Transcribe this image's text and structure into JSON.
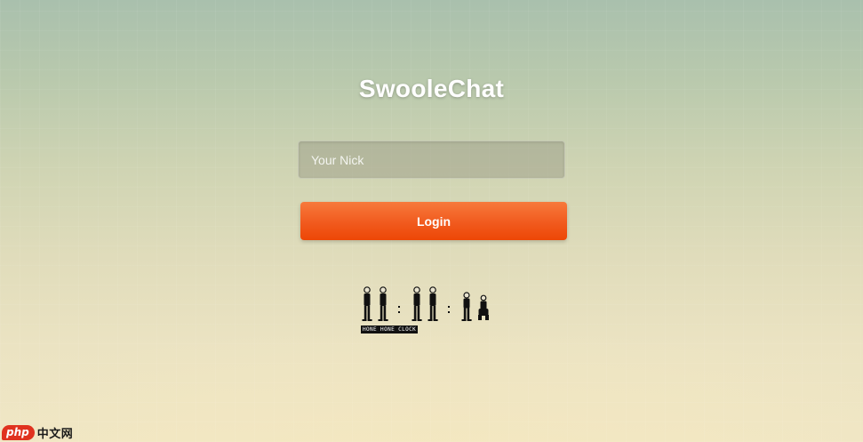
{
  "app": {
    "title": "SwooleChat"
  },
  "form": {
    "nick_value": "",
    "nick_placeholder": "Your Nick",
    "login_label": "Login"
  },
  "clock": {
    "caption": "HONE HONE CLOCK"
  },
  "watermark": {
    "php_text": "php",
    "site_text": "中文网"
  },
  "colors": {
    "accent": "#f15a1e",
    "title_text": "#ffffff"
  }
}
